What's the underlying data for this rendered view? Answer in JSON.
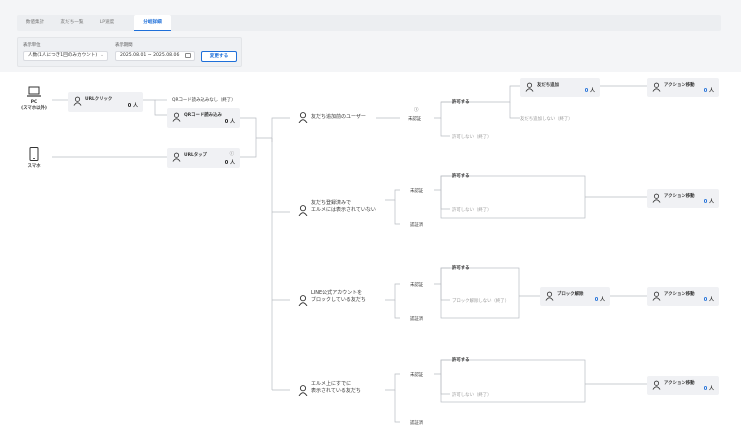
{
  "tabs": [
    "数値集計",
    "友だち一覧",
    "LP速度",
    "分岐詳細"
  ],
  "filter": {
    "unit_label": "表示単位",
    "unit_value": "人数(1人につき1回のみカウント)",
    "period_label": "表示期間",
    "period_value": "2025.08.01 ~ 2025.08.06",
    "apply_label": "変更する"
  },
  "devices": {
    "pc_name": "PC",
    "pc_sub": "(スマホ以外)",
    "sp_name": "スマホ"
  },
  "nodes": {
    "url_click": {
      "label": "URLクリック",
      "count": "0",
      "unit": "人"
    },
    "qr_no_scan": "QRコード読み込みなし（終了）",
    "qr_scan": {
      "label": "QRコード読み込み",
      "count": "0",
      "unit": "人"
    },
    "url_tap": {
      "label": "URLタップ",
      "count": "0",
      "unit": "人",
      "info": "ⓘ"
    },
    "friend_add": {
      "label": "友だち追加",
      "count": "0",
      "unit": "人"
    },
    "block_action": {
      "label": "ブロック解除",
      "count": "0",
      "unit": "人"
    },
    "action": {
      "label": "アクション移動",
      "count": "0",
      "unit": "人"
    }
  },
  "segments": {
    "s1": "友だち追加前のユーザー",
    "s2a": "友だち登録済みで",
    "s2b": "エルメには表示されていない",
    "s3a": "LINE公式アカウントを",
    "s3b": "ブロックしている友だち",
    "s4a": "エルメ上にすでに",
    "s4b": "表示されている友だち"
  },
  "labels": {
    "unauth": "未認証",
    "authed": "認証済",
    "allow": "許可する",
    "deny_end": "許可しない（終了）",
    "no_add_end": "友だち追加しない（終了）",
    "no_unblock_end": "ブロック解除しない（終了）",
    "info_icon": "ⓘ"
  }
}
